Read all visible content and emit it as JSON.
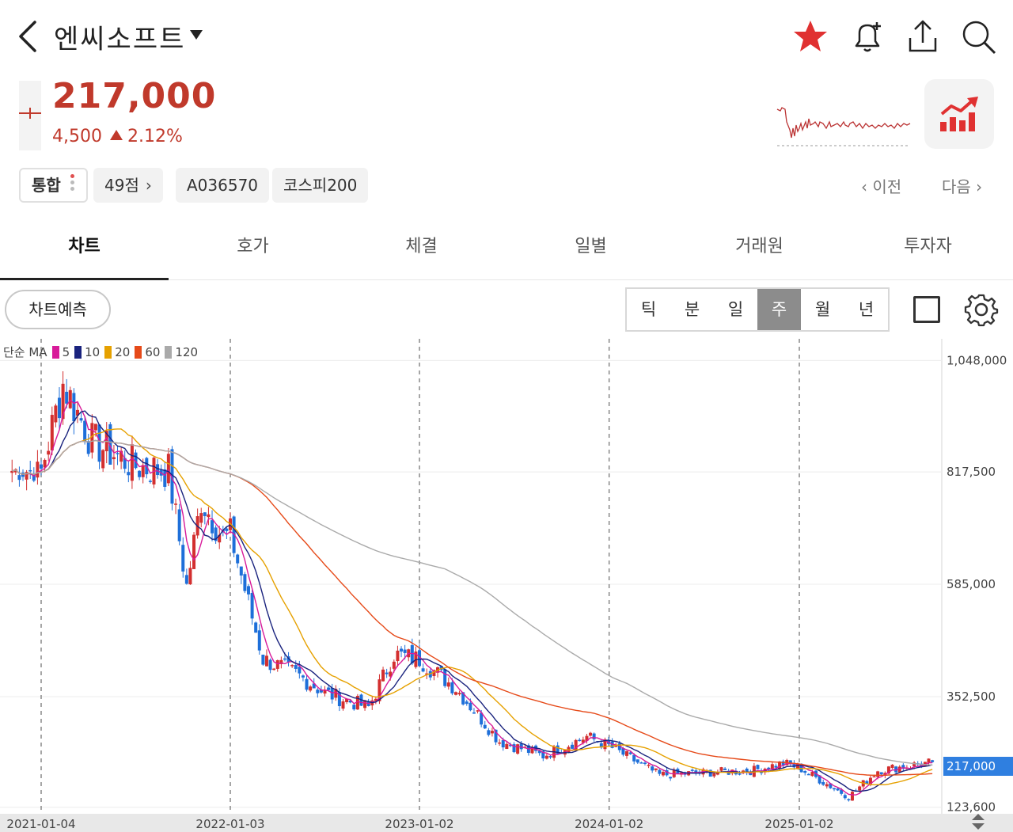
{
  "header": {
    "stock_name": "엔씨소프트",
    "icons": [
      "back-icon",
      "star-icon",
      "bell-plus-icon",
      "share-icon",
      "search-icon"
    ]
  },
  "quote": {
    "price": "217,000",
    "change": "4,500",
    "change_pct": "2.12%",
    "direction": "up",
    "up_color": "#c0392b"
  },
  "chips": {
    "market": "통합",
    "score": "49점",
    "code": "A036570",
    "index": "코스피200"
  },
  "nav": {
    "prev": "이전",
    "next": "다음"
  },
  "tabs": [
    "차트",
    "호가",
    "체결",
    "일별",
    "거래원",
    "투자자"
  ],
  "active_tab": 0,
  "chart_controls": {
    "predict": "차트예측",
    "periods": [
      "틱",
      "분",
      "일",
      "주",
      "월",
      "년"
    ],
    "active_period": 3
  },
  "chart_data": {
    "type": "candlestick",
    "interval": "weekly",
    "legend_prefix": "단순 MA",
    "ma_series": [
      {
        "name": "5",
        "color": "#d81b9a"
      },
      {
        "name": "10",
        "color": "#1a237e"
      },
      {
        "name": "20",
        "color": "#e6a100"
      },
      {
        "name": "60",
        "color": "#e64a19"
      },
      {
        "name": "120",
        "color": "#aaaaaa"
      }
    ],
    "y_ticks": [
      "1,048,000",
      "817,500",
      "585,000",
      "352,500",
      "123,600"
    ],
    "y_tick_values": [
      1048000,
      817500,
      585000,
      352500,
      123600
    ],
    "ylim": [
      110000,
      1070000
    ],
    "x_ticks": [
      "2021-01-04",
      "2022-01-03",
      "2023-01-02",
      "2024-01-02",
      "2025-01-02"
    ],
    "current_price_label": "217,000",
    "current_price": 217000,
    "up_color": "#d32f2f",
    "down_color": "#1e6fd9",
    "trend_points": [
      {
        "date": "2021-01-04",
        "close": 820000
      },
      {
        "date": "2021-02-15",
        "close": 1000000
      },
      {
        "date": "2021-04-12",
        "close": 880000
      },
      {
        "date": "2021-07-05",
        "close": 830000
      },
      {
        "date": "2021-09-06",
        "close": 820000
      },
      {
        "date": "2021-10-11",
        "close": 580000
      },
      {
        "date": "2021-11-08",
        "close": 760000
      },
      {
        "date": "2021-12-20",
        "close": 680000
      },
      {
        "date": "2022-01-03",
        "close": 690000
      },
      {
        "date": "2022-03-07",
        "close": 430000
      },
      {
        "date": "2022-05-09",
        "close": 400000
      },
      {
        "date": "2022-07-04",
        "close": 360000
      },
      {
        "date": "2022-09-26",
        "close": 330000
      },
      {
        "date": "2022-11-14",
        "close": 440000
      },
      {
        "date": "2023-01-02",
        "close": 430000
      },
      {
        "date": "2023-03-13",
        "close": 370000
      },
      {
        "date": "2023-06-05",
        "close": 260000
      },
      {
        "date": "2023-08-28",
        "close": 230000
      },
      {
        "date": "2023-11-20",
        "close": 270000
      },
      {
        "date": "2024-01-02",
        "close": 250000
      },
      {
        "date": "2024-04-08",
        "close": 190000
      },
      {
        "date": "2024-07-01",
        "close": 195000
      },
      {
        "date": "2024-10-07",
        "close": 200000
      },
      {
        "date": "2024-12-02",
        "close": 215000
      },
      {
        "date": "2025-01-02",
        "close": 205000
      },
      {
        "date": "2025-04-07",
        "close": 145000
      },
      {
        "date": "2025-06-02",
        "close": 200000
      },
      {
        "date": "2025-08-04",
        "close": 210000
      },
      {
        "date": "2025-09-15",
        "close": 217000
      }
    ]
  }
}
